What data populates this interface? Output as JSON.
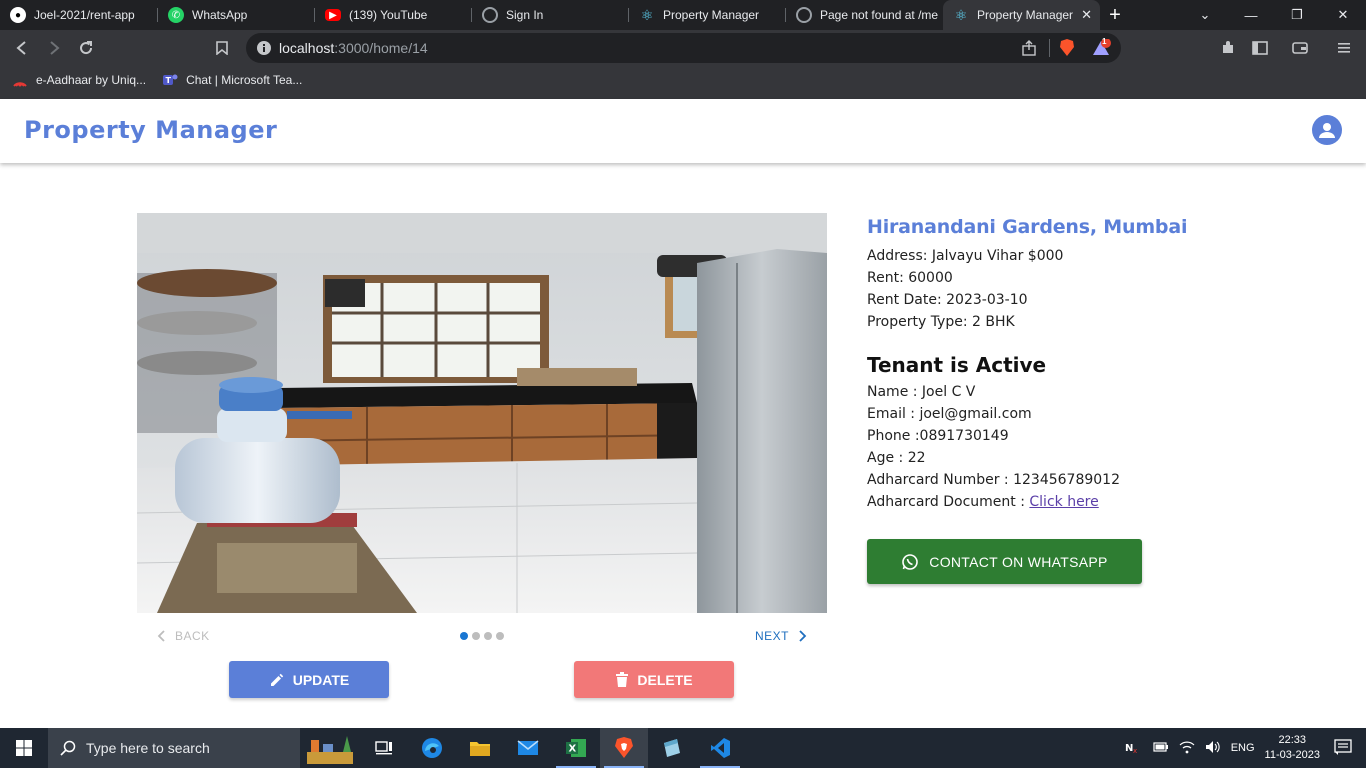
{
  "browser": {
    "tabs": [
      {
        "title": "Joel-2021/rent-app",
        "icon": "github-icon",
        "color": "#ffffff"
      },
      {
        "title": "WhatsApp",
        "icon": "whatsapp-icon",
        "color": "#25d366"
      },
      {
        "title": "(139) YouTube",
        "icon": "youtube-icon",
        "color": "#ff0000"
      },
      {
        "title": "Sign In",
        "icon": "globe-icon",
        "color": "#9aa0a6"
      },
      {
        "title": "Property Manager",
        "icon": "react-icon",
        "color": "#61dafb"
      },
      {
        "title": "Page not found at /me",
        "icon": "globe-icon",
        "color": "#9aa0a6"
      },
      {
        "title": "Property Manager",
        "icon": "react-icon",
        "color": "#61dafb",
        "active": true
      }
    ],
    "url_host": "localhost",
    "url_path": ":3000/home/14",
    "brave_badge": "1",
    "bookmarks": [
      {
        "label": "e-Aadhaar by Uniq...",
        "icon": "aadhaar-icon"
      },
      {
        "label": "Chat | Microsoft Tea...",
        "icon": "teams-icon"
      }
    ]
  },
  "app": {
    "brand": "Property Manager",
    "accent": "#5b7fd8"
  },
  "carousel": {
    "back_label": "BACK",
    "next_label": "NEXT",
    "step_count": 4,
    "active_step": 1
  },
  "actions": {
    "update_label": "UPDATE",
    "delete_label": "DELETE"
  },
  "property": {
    "title": "Hiranandani Gardens, Mumbai",
    "address": "Address: Jalvayu Vihar $000",
    "rent": "Rent: 60000",
    "rent_date": "Rent Date: 2023-03-10",
    "type": "Property Type: 2 BHK"
  },
  "tenant": {
    "heading": "Tenant is Active",
    "name": "Name : Joel C V",
    "email": "Email : joel@gmail.com",
    "phone": "Phone :0891730149",
    "age": "Age : 22",
    "aadhar_number": "Adharcard Number : 123456789012",
    "aadhar_doc_label": "Adharcard Document : ",
    "aadhar_doc_link": "Click here",
    "whatsapp_label": "CONTACT ON WHATSAPP"
  },
  "taskbar": {
    "search_placeholder": "Type here to search",
    "lang": "ENG",
    "time": "22:33",
    "date": "11-03-2023"
  }
}
